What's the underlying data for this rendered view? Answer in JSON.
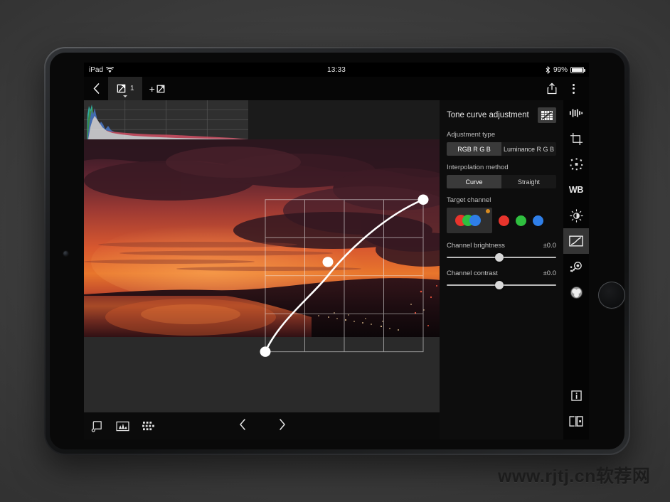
{
  "status_bar": {
    "device": "iPad",
    "wifi_icon": "wifi-icon",
    "time": "13:33",
    "bluetooth_icon": "bluetooth-icon",
    "battery_percent": "99%"
  },
  "toolbar": {
    "back_icon": "chevron-left-icon",
    "layer_tab_icon": "layer-icon",
    "layer_count": "1",
    "add_layer_label": "+",
    "add_layer_icon": "add-layer-icon",
    "share_icon": "share-icon",
    "more_icon": "more-vertical-icon"
  },
  "panel": {
    "title": "Tone curve adjustment",
    "title_icon": "curve-graph-icon",
    "adjustment_type": {
      "label": "Adjustment type",
      "options": [
        "RGB R G B",
        "Luminance R G B"
      ],
      "selected": "RGB R G B"
    },
    "interpolation_method": {
      "label": "Interpolation method",
      "options": [
        "Curve",
        "Straight"
      ],
      "selected": "Curve"
    },
    "target_channel": {
      "label": "Target channel",
      "selected": "rgb-composite",
      "swatches": [
        {
          "name": "rgb-composite",
          "colors": [
            "#e8342c",
            "#2fbf3f",
            "#2f7fe8"
          ]
        },
        {
          "name": "red-channel",
          "color": "#e8342c"
        },
        {
          "name": "green-channel",
          "color": "#2fbf3f"
        },
        {
          "name": "blue-channel",
          "color": "#2f7fe8"
        }
      ],
      "modified_badge_color": "#d98b20"
    },
    "sliders": [
      {
        "name": "Channel brightness",
        "value": "±0.0",
        "position_pct": 44
      },
      {
        "name": "Channel contrast",
        "value": "±0.0",
        "position_pct": 44
      }
    ]
  },
  "rail": {
    "items": [
      {
        "name": "tone-levels-icon",
        "active": false
      },
      {
        "name": "crop-icon",
        "active": false
      },
      {
        "name": "detail-sharpen-icon",
        "active": false
      },
      {
        "name": "white-balance-icon",
        "label": "WB",
        "active": false
      },
      {
        "name": "exposure-brightness-icon",
        "active": false
      },
      {
        "name": "tone-curve-icon",
        "active": true
      },
      {
        "name": "spot-repair-icon",
        "active": false
      },
      {
        "name": "color-mixer-icon",
        "active": false
      },
      {
        "name": "info-icon",
        "active": false
      },
      {
        "name": "before-after-compare-icon",
        "active": false
      }
    ]
  },
  "bottom_bar": {
    "items": [
      {
        "name": "film-strip-icon"
      },
      {
        "name": "photo-thumbnail-icon"
      },
      {
        "name": "grid-view-icon"
      }
    ],
    "prev_icon": "chevron-left-icon",
    "next_icon": "chevron-right-icon"
  },
  "curve": {
    "points": [
      {
        "x": 0.0,
        "y": 0.0
      },
      {
        "x": 0.4,
        "y": 0.59
      },
      {
        "x": 1.0,
        "y": 1.0
      }
    ],
    "grid_divisions": 4,
    "line_color": "#ffffff",
    "point_color": "#ffffff"
  },
  "histogram": {
    "channels": [
      "red",
      "green",
      "blue",
      "luminance"
    ],
    "grid_cols": 4
  },
  "watermark": "www.rjtj.cn软荐网"
}
